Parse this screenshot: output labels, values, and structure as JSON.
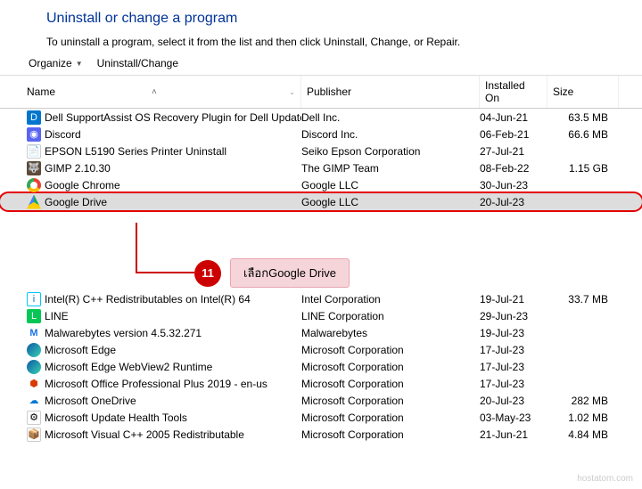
{
  "header": {
    "title": "Uninstall or change a program",
    "subtitle": "To uninstall a program, select it from the list and then click Uninstall, Change, or Repair."
  },
  "toolbar": {
    "organize": "Organize",
    "uninstall": "Uninstall/Change"
  },
  "columns": {
    "name": "Name",
    "publisher": "Publisher",
    "installed": "Installed On",
    "size": "Size"
  },
  "rows_top": [
    {
      "icon": "i-dell",
      "glyph": "D",
      "name": "Dell SupportAssist OS Recovery Plugin for Dell Update",
      "publisher": "Dell Inc.",
      "date": "04-Jun-21",
      "size": "63.5 MB"
    },
    {
      "icon": "i-discord",
      "glyph": "◉",
      "name": "Discord",
      "publisher": "Discord Inc.",
      "date": "06-Feb-21",
      "size": "66.6 MB"
    },
    {
      "icon": "i-epson",
      "glyph": "📄",
      "name": "EPSON L5190 Series Printer Uninstall",
      "publisher": "Seiko Epson Corporation",
      "date": "27-Jul-21",
      "size": ""
    },
    {
      "icon": "i-gimp",
      "glyph": "🐺",
      "name": "GIMP 2.10.30",
      "publisher": "The GIMP Team",
      "date": "08-Feb-22",
      "size": "1.15 GB"
    },
    {
      "icon": "i-chrome",
      "glyph": "",
      "name": "Google Chrome",
      "publisher": "Google LLC",
      "date": "30-Jun-23",
      "size": ""
    }
  ],
  "highlight_row": {
    "icon": "i-drive",
    "glyph": "",
    "name": "Google Drive",
    "publisher": "Google LLC",
    "date": "20-Jul-23",
    "size": ""
  },
  "rows_bottom": [
    {
      "icon": "i-intel",
      "glyph": "i",
      "name": "Intel(R) C++ Redistributables on Intel(R) 64",
      "publisher": "Intel Corporation",
      "date": "19-Jul-21",
      "size": "33.7 MB"
    },
    {
      "icon": "i-line",
      "glyph": "L",
      "name": "LINE",
      "publisher": "LINE Corporation",
      "date": "29-Jun-23",
      "size": ""
    },
    {
      "icon": "i-mwb",
      "glyph": "M",
      "name": "Malwarebytes version 4.5.32.271",
      "publisher": "Malwarebytes",
      "date": "19-Jul-23",
      "size": ""
    },
    {
      "icon": "i-edge",
      "glyph": "",
      "name": "Microsoft Edge",
      "publisher": "Microsoft Corporation",
      "date": "17-Jul-23",
      "size": ""
    },
    {
      "icon": "i-edge",
      "glyph": "",
      "name": "Microsoft Edge WebView2 Runtime",
      "publisher": "Microsoft Corporation",
      "date": "17-Jul-23",
      "size": ""
    },
    {
      "icon": "i-office",
      "glyph": "⬢",
      "name": "Microsoft Office Professional Plus 2019 - en-us",
      "publisher": "Microsoft Corporation",
      "date": "17-Jul-23",
      "size": ""
    },
    {
      "icon": "i-onedrive",
      "glyph": "☁",
      "name": "Microsoft OneDrive",
      "publisher": "Microsoft Corporation",
      "date": "20-Jul-23",
      "size": "282 MB"
    },
    {
      "icon": "i-update",
      "glyph": "⚙",
      "name": "Microsoft Update Health Tools",
      "publisher": "Microsoft Corporation",
      "date": "03-May-23",
      "size": "1.02 MB"
    },
    {
      "icon": "i-vc",
      "glyph": "📦",
      "name": "Microsoft Visual C++ 2005 Redistributable",
      "publisher": "Microsoft Corporation",
      "date": "21-Jun-21",
      "size": "4.84 MB"
    }
  ],
  "callout": {
    "number": "11",
    "text": "เลือกGoogle Drive"
  },
  "watermark": "hostatom.com"
}
